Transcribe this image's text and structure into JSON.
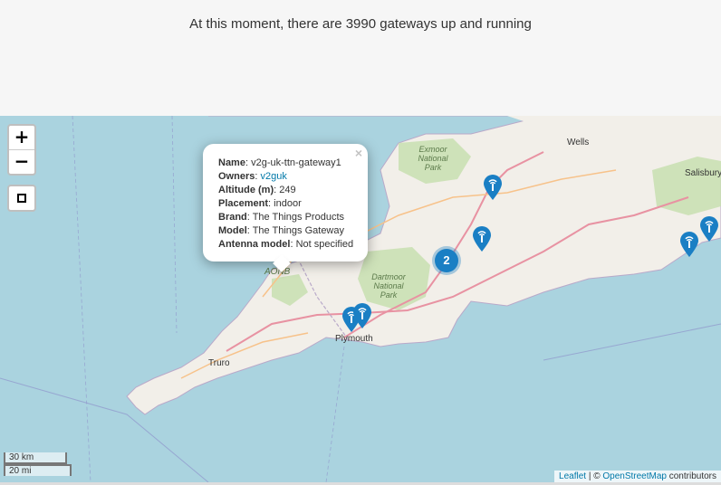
{
  "header": {
    "headline": "At this moment, there are 3990 gateways up and running"
  },
  "map": {
    "zoom_in": "+",
    "zoom_out": "−",
    "places": [
      {
        "name": "Wells"
      },
      {
        "name": "Salisbury"
      },
      {
        "name": "Plymouth"
      },
      {
        "name": "Truro"
      },
      {
        "name": "AONB"
      }
    ],
    "parks": {
      "exmoor": [
        "Exmoor",
        "National",
        "Park"
      ],
      "dartmoor": [
        "Dartmoor",
        "National",
        "Park"
      ]
    },
    "cluster_count": "2",
    "popup": {
      "close": "×",
      "fields": [
        {
          "label": "Name",
          "value": "v2g-uk-ttn-gateway1"
        },
        {
          "label": "Owners",
          "value": "v2guk",
          "link": true
        },
        {
          "label": "Altitude (m)",
          "value": "249"
        },
        {
          "label": "Placement",
          "value": "indoor"
        },
        {
          "label": "Brand",
          "value": "The Things Products"
        },
        {
          "label": "Model",
          "value": "The Things Gateway"
        },
        {
          "label": "Antenna model",
          "value": "Not specified"
        }
      ]
    },
    "scale": {
      "km": "30 km",
      "mi": "20 mi"
    },
    "attribution": {
      "leaflet": "Leaflet",
      "sep": " | © ",
      "osm": "OpenStreetMap",
      "suffix": " contributors"
    },
    "colors": {
      "sea": "#aad3df",
      "land": "#f2efe9",
      "park": "#c8dfb0",
      "marker": "#1a7fc4"
    }
  }
}
